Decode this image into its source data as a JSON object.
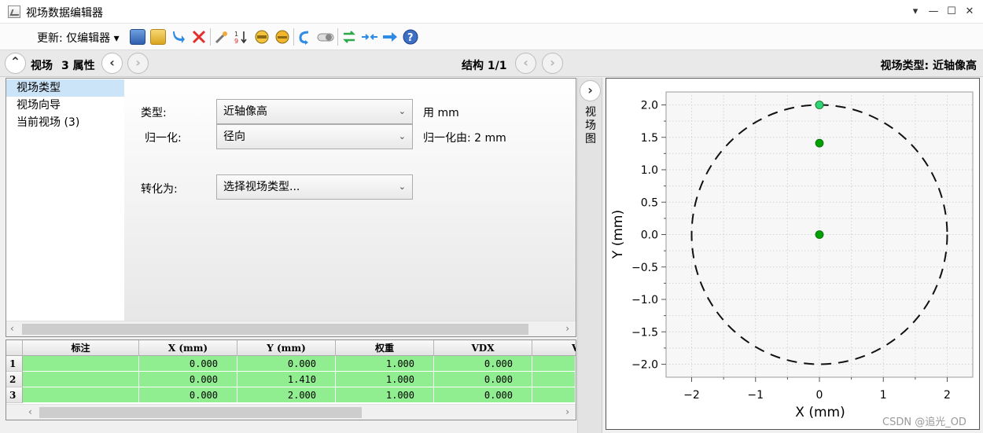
{
  "window": {
    "title": "视场数据编辑器",
    "minimize": "▾",
    "min_label": "—",
    "max_label": "☐",
    "close_label": "✕"
  },
  "toolbar": {
    "update_label": "更新: 仅编辑器 ▾"
  },
  "nav": {
    "section": "视场",
    "props_count": "3 属性",
    "structure": "结构 1/1",
    "field_type": "视场类型: 近轴像高"
  },
  "tree": {
    "items": [
      {
        "label": "视场类型"
      },
      {
        "label": "视场向导"
      },
      {
        "label": "当前视场 (3)"
      }
    ]
  },
  "form": {
    "type_label": "类型:",
    "type_value": "近轴像高",
    "type_note": "用 mm",
    "norm_label": "归一化:",
    "norm_value": "径向",
    "norm_note": "归一化由: 2 mm",
    "convert_label": "转化为:",
    "convert_value": "选择视场类型..."
  },
  "grid": {
    "columns": [
      "标注",
      "X (mm)",
      "Y (mm)",
      "权重",
      "VDX",
      "V"
    ],
    "rows": [
      {
        "num": "1",
        "cells": [
          "",
          "0.000",
          "0.000",
          "1.000",
          "0.000"
        ]
      },
      {
        "num": "2",
        "cells": [
          "",
          "0.000",
          "1.410",
          "1.000",
          "0.000"
        ]
      },
      {
        "num": "3",
        "cells": [
          "",
          "0.000",
          "2.000",
          "1.000",
          "0.000"
        ]
      }
    ]
  },
  "side": {
    "label": "视场图"
  },
  "chart_data": {
    "type": "scatter",
    "xlabel": "X (mm)",
    "ylabel": "Y (mm)",
    "xlim": [
      -2.4,
      2.4
    ],
    "ylim": [
      -2.2,
      2.2
    ],
    "xticks": [
      -2,
      -1,
      0,
      1,
      2
    ],
    "yticks": [
      -2.0,
      -1.5,
      -1.0,
      -0.5,
      0.0,
      0.5,
      1.0,
      1.5,
      2.0
    ],
    "ytick_labels": [
      "−2.0",
      "−1.5",
      "−1.0",
      "−0.5",
      "0.0",
      "0.5",
      "1.0",
      "1.5",
      "2.0"
    ],
    "xtick_labels": [
      "−2",
      "−1",
      "0",
      "1",
      "2"
    ],
    "grid": true,
    "circle_radius": 2,
    "points": [
      {
        "x": 0.0,
        "y": 0.0,
        "color": "#00a000"
      },
      {
        "x": 0.0,
        "y": 1.41,
        "color": "#00a000"
      },
      {
        "x": 0.0,
        "y": 2.0,
        "color": "#2ed47a"
      }
    ]
  },
  "watermark": "CSDN @追光_OD"
}
